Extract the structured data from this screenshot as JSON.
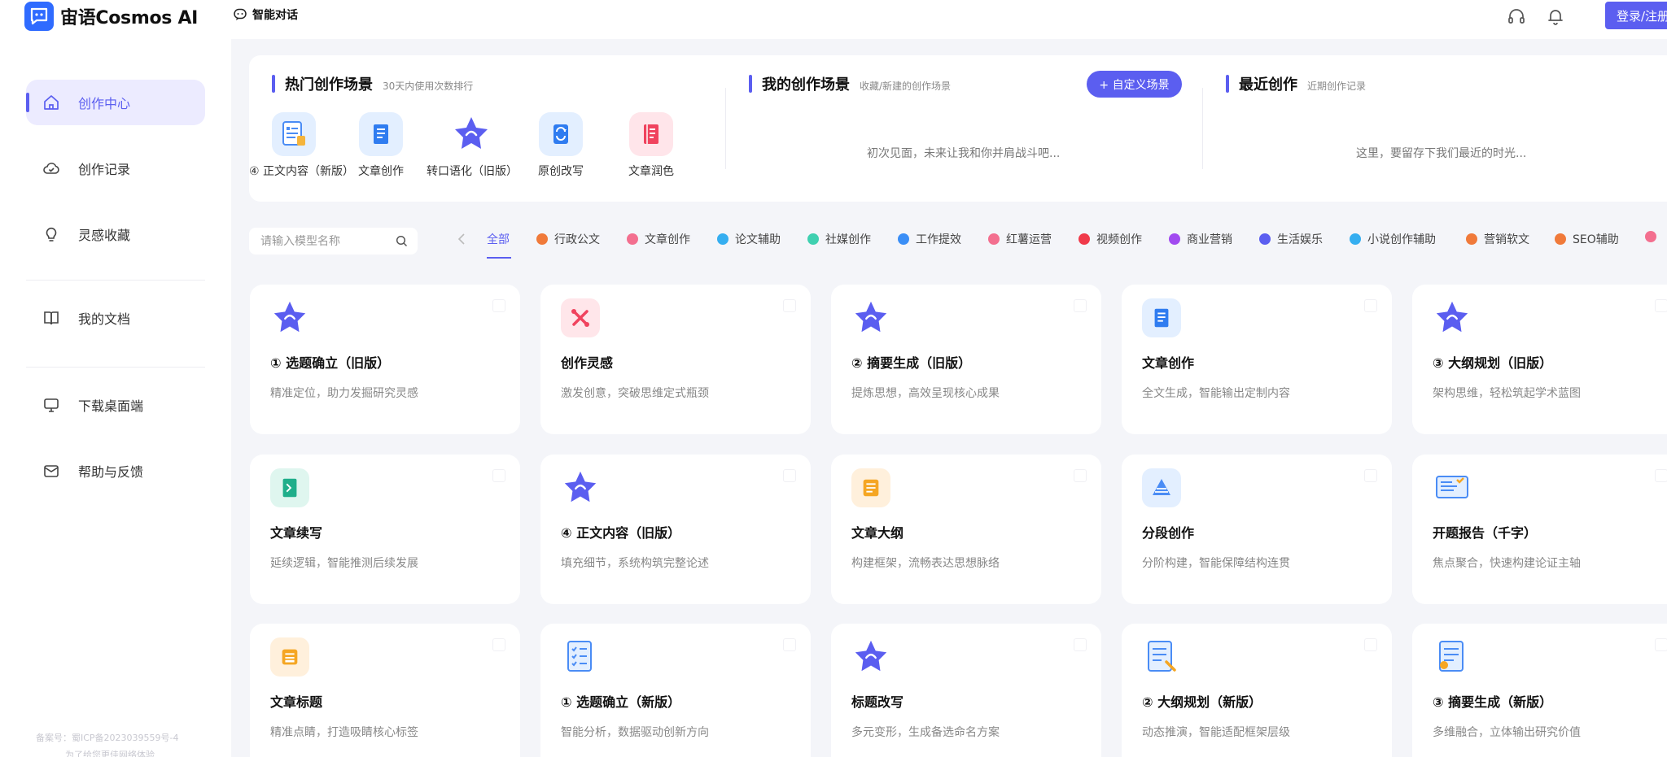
{
  "app": {
    "name": "宙语Cosmos AI"
  },
  "header": {
    "chat_label": "智能对话",
    "login_label": "登录/注册"
  },
  "colors": {
    "accent": "#5b5ef0",
    "active_bg": "#ecebff",
    "logo_blue": "#2f6bff"
  },
  "sidebar": {
    "items": [
      {
        "label": "创作中心",
        "icon": "home-icon",
        "active": true
      },
      {
        "label": "创作记录",
        "icon": "cloud-icon",
        "active": false
      },
      {
        "label": "灵感收藏",
        "icon": "lightbulb-icon",
        "active": false
      },
      {
        "label": "我的文档",
        "icon": "book-icon",
        "active": false
      },
      {
        "label": "下载桌面端",
        "icon": "monitor-icon",
        "active": false
      },
      {
        "label": "帮助与反馈",
        "icon": "mail-icon",
        "active": false
      }
    ],
    "footer": [
      "备案号：蜀ICP备2023039559号-4",
      "为了给您更佳网络体验"
    ]
  },
  "hot": {
    "title": "热门创作场景",
    "subtitle": "30天内使用次数排行",
    "items": [
      {
        "label": "④ 正文内容（新版）",
        "icon": "document-chart-icon"
      },
      {
        "label": "文章创作",
        "icon": "book-icon"
      },
      {
        "label": "转口语化（旧版）",
        "icon": "star-icon"
      },
      {
        "label": "原创改写",
        "icon": "rewrite-icon"
      },
      {
        "label": "文章润色",
        "icon": "red-book-icon"
      }
    ]
  },
  "mine": {
    "title": "我的创作场景",
    "subtitle": "收藏/新建的创作场景",
    "button": "+ 自定义场景",
    "empty": "初次见面，未来让我和你并肩战斗吧..."
  },
  "recent": {
    "title": "最近创作",
    "subtitle": "近期创作记录",
    "empty": "这里，要留存下我们最近的时光..."
  },
  "search": {
    "placeholder": "请输入模型名称"
  },
  "categories": [
    {
      "label": "全部",
      "color": ""
    },
    {
      "label": "行政公文",
      "color": "#f07a3a"
    },
    {
      "label": "文章创作",
      "color": "#f36f8f"
    },
    {
      "label": "论文辅助",
      "color": "#35aef0"
    },
    {
      "label": "社媒创作",
      "color": "#3fd0b0"
    },
    {
      "label": "工作提效",
      "color": "#3a8ef6"
    },
    {
      "label": "红薯运营",
      "color": "#f36f8f"
    },
    {
      "label": "视频创作",
      "color": "#f03a4a"
    },
    {
      "label": "商业营销",
      "color": "#a14af0"
    },
    {
      "label": "生活娱乐",
      "color": "#5b5ef0"
    },
    {
      "label": "小说创作辅助",
      "color": "#35aef0"
    },
    {
      "label": "营销软文",
      "color": "#f07a3a"
    },
    {
      "label": "SEO辅助",
      "color": "#f07a3a"
    }
  ],
  "cards": [
    {
      "title": "① 选题确立（旧版）",
      "desc": "精准定位，助力发掘研究灵感",
      "icon": "star-icon"
    },
    {
      "title": "创作灵感",
      "desc": "激发创意，突破思维定式瓶颈",
      "icon": "inspiration-icon"
    },
    {
      "title": "② 摘要生成（旧版）",
      "desc": "提炼思想，高效呈现核心成果",
      "icon": "star-icon"
    },
    {
      "title": "文章创作",
      "desc": "全文生成，智能输出定制内容",
      "icon": "book-icon"
    },
    {
      "title": "③ 大纲规划（旧版）",
      "desc": "架构思维，轻松筑起学术蓝图",
      "icon": "star-icon"
    },
    {
      "title": "文章续写",
      "desc": "延续逻辑，智能推测后续发展",
      "icon": "continue-icon"
    },
    {
      "title": "④ 正文内容（旧版）",
      "desc": "填充细节，系统构筑完整论述",
      "icon": "star-icon"
    },
    {
      "title": "文章大纲",
      "desc": "构建框架，流畅表达思想脉络",
      "icon": "outline-icon"
    },
    {
      "title": "分段创作",
      "desc": "分阶构建，智能保障结构连贯",
      "icon": "pyramid-icon"
    },
    {
      "title": "开题报告（千字）",
      "desc": "焦点聚合，快速构建论证主轴",
      "icon": "report-icon"
    },
    {
      "title": "文章标题",
      "desc": "精准点睛，打造吸睛核心标签",
      "icon": "title-icon"
    },
    {
      "title": "① 选题确立（新版）",
      "desc": "智能分析，数据驱动创新方向",
      "icon": "checklist-icon"
    },
    {
      "title": "标题改写",
      "desc": "多元变形，生成备选命名方案",
      "icon": "star-icon"
    },
    {
      "title": "② 大纲规划（新版）",
      "desc": "动态推演，智能适配框架层级",
      "icon": "document-edit-icon"
    },
    {
      "title": "③ 摘要生成（新版）",
      "desc": "多维融合，立体输出研究价值",
      "icon": "document-chart-icon"
    }
  ]
}
